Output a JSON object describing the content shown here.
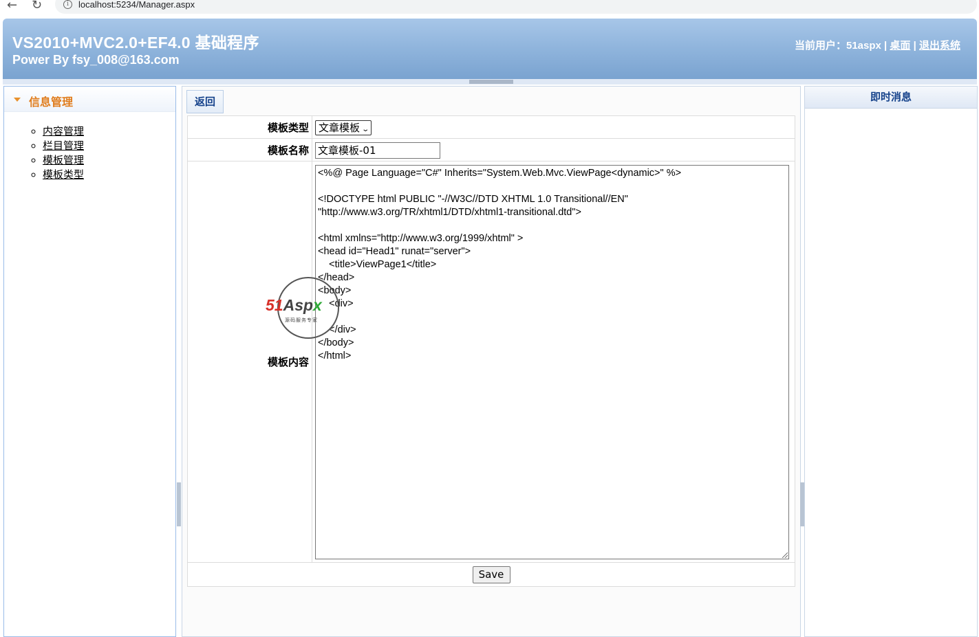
{
  "browser": {
    "url": "localhost:5234/Manager.aspx",
    "back_icon": "←",
    "reload_icon": "↻",
    "info_icon": "i"
  },
  "header": {
    "title": "VS2010+MVC2.0+EF4.0 基础程序",
    "subtitle": "Power By fsy_008@163.com",
    "user_prefix": "当前用户：51aspx | ",
    "desktop_link": "桌面",
    "separator": " | ",
    "logout_link": "退出系统"
  },
  "sidebar": {
    "title": "信息管理",
    "items": [
      {
        "label": "内容管理"
      },
      {
        "label": "栏目管理"
      },
      {
        "label": "模板管理"
      },
      {
        "label": "模板类型"
      }
    ]
  },
  "main": {
    "back_label": "返回",
    "form": {
      "type_label": "模板类型",
      "type_value": "文章模板",
      "name_label": "模板名称",
      "name_value": "文章模板-01",
      "content_label": "模板内容",
      "content_value": "<%@ Page Language=\"C#\" Inherits=\"System.Web.Mvc.ViewPage<dynamic>\" %>\n\n<!DOCTYPE html PUBLIC \"-//W3C//DTD XHTML 1.0 Transitional//EN\"\n\"http://www.w3.org/TR/xhtml1/DTD/xhtml1-transitional.dtd\">\n\n<html xmlns=\"http://www.w3.org/1999/xhtml\" >\n<head id=\"Head1\" runat=\"server\">\n    <title>ViewPage1</title>\n</head>\n<body>\n    <div>\n    \n    </div>\n</body>\n</html>",
      "save_label": "Save"
    }
  },
  "right_panel": {
    "title": "即时消息"
  },
  "watermark": {
    "logo_part1": "51",
    "logo_part2": "Asp",
    "logo_part3": "x",
    "tagline": "源码服务专家"
  }
}
